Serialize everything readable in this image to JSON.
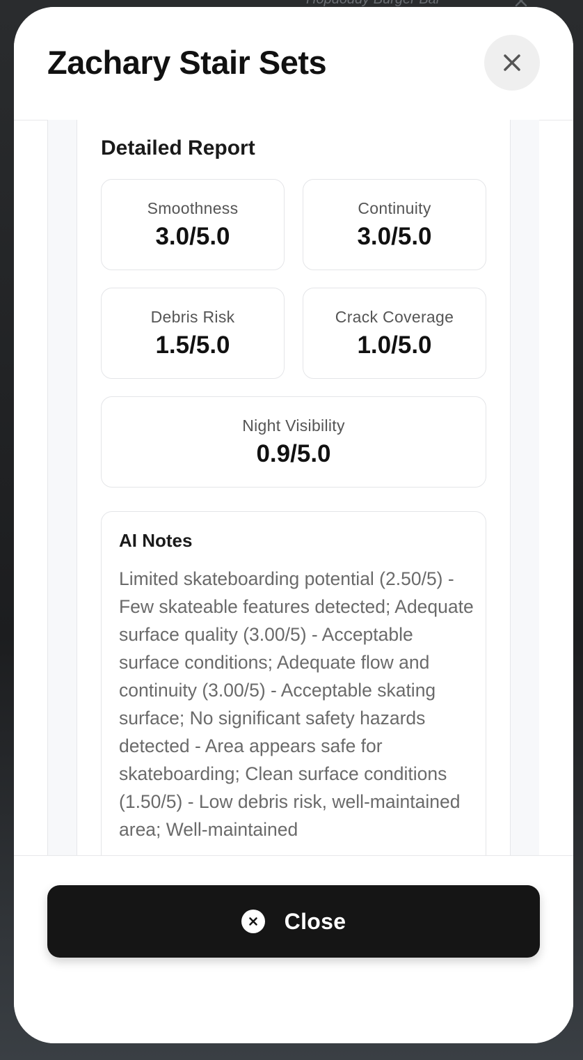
{
  "background": {
    "map_label": "Hopdoddy Burger Bar"
  },
  "modal": {
    "title": "Zachary Stair Sets",
    "close_icon": "close-icon"
  },
  "report": {
    "section_title": "Detailed Report",
    "metrics": [
      {
        "label": "Smoothness",
        "value": "3.0/5.0"
      },
      {
        "label": "Continuity",
        "value": "3.0/5.0"
      },
      {
        "label": "Debris Risk",
        "value": "1.5/5.0"
      },
      {
        "label": "Crack Coverage",
        "value": "1.0/5.0"
      },
      {
        "label": "Night Visibility",
        "value": "0.9/5.0"
      }
    ],
    "ai_notes": {
      "title": "AI Notes",
      "text": "Limited skateboarding potential (2.50/5) - Few skateable features detected; Adequate surface quality (3.00/5) - Acceptable surface conditions; Adequate flow and continuity (3.00/5) - Acceptable skating surface; No significant safety hazards detected - Area appears safe for skateboarding; Clean surface conditions (1.50/5) - Low debris risk, well-maintained area; Well-maintained"
    }
  },
  "footer": {
    "close_label": "Close",
    "close_icon": "close-circle-icon"
  },
  "colors": {
    "button_background": "#151515",
    "panel_background": "#f7f8fa",
    "text_primary": "#111111",
    "text_secondary": "#6a6a6a"
  }
}
